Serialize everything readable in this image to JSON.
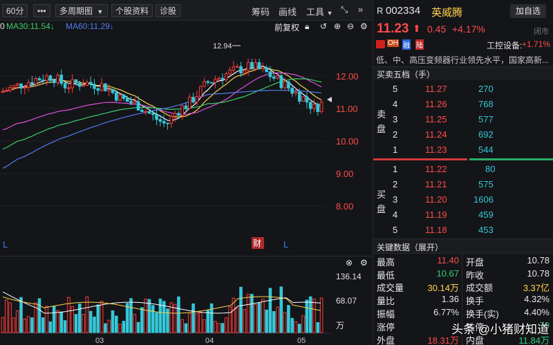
{
  "toolbar": {
    "period": "60分",
    "more": "•••",
    "multi_period": "多周期图",
    "dropdown_arrow": "▼",
    "stock_info": "个股资料",
    "diagnose": "诊股",
    "chips": "筹码",
    "draw_line": "画线",
    "tools": "工具",
    "fuquan": "前复权"
  },
  "ma_legend": {
    "ma_prefix": "0",
    "ma30": "MA30:11.54",
    "ma60": "MA60:11.29",
    "arrow_down": "↓",
    "colors": {
      "ma30": "#3ad06a",
      "ma60": "#4f7df0"
    }
  },
  "price_axis": {
    "labels": [
      "12.00",
      "11.00",
      "10.00",
      "9.00",
      "8.00"
    ],
    "values": [
      12.0,
      11.0,
      10.0,
      9.0,
      8.0
    ],
    "max_marker": "12.94"
  },
  "markers": {
    "left_l": "L",
    "cai": "财",
    "right_l": "L"
  },
  "volume": {
    "axis_labels": [
      "136.14",
      "68.07"
    ],
    "unit": "万",
    "x_labels": [
      "03",
      "04",
      "05"
    ]
  },
  "quote": {
    "market": "R",
    "code": "002334",
    "name": "英威腾",
    "add_watch": "加自选",
    "price": "11.23",
    "change": "0.45",
    "change_pct": "+4.17%",
    "status": "闭市",
    "tags": [
      "OH",
      "融",
      "陆"
    ],
    "sector": "工控设备:",
    "sector_pct": "+1.71%",
    "desc": "低、中、高压变频器行业领先水平，国家高新..."
  },
  "orderbook": {
    "title": "买卖五档（手）",
    "sell_label": [
      "卖",
      "盘"
    ],
    "buy_label": [
      "买",
      "盘"
    ],
    "sell": [
      {
        "level": "5",
        "price": "11.27",
        "vol": "270"
      },
      {
        "level": "4",
        "price": "11.26",
        "vol": "768"
      },
      {
        "level": "3",
        "price": "11.25",
        "vol": "577"
      },
      {
        "level": "2",
        "price": "11.24",
        "vol": "692"
      },
      {
        "level": "1",
        "price": "11.23",
        "vol": "544"
      }
    ],
    "buy": [
      {
        "level": "1",
        "price": "11.22",
        "vol": "80"
      },
      {
        "level": "2",
        "price": "11.21",
        "vol": "575"
      },
      {
        "level": "3",
        "price": "11.20",
        "vol": "1606"
      },
      {
        "level": "4",
        "price": "11.19",
        "vol": "459"
      },
      {
        "level": "5",
        "price": "11.18",
        "vol": "453"
      }
    ]
  },
  "key_data": {
    "title": "关键数据（展开）",
    "rows": [
      {
        "l1": "最高",
        "v1": "11.40",
        "l2": "开盘",
        "v2": "10.78"
      },
      {
        "l1": "最低",
        "v1": "10.67",
        "l2": "昨收",
        "v2": "10.78"
      },
      {
        "l1": "成交量",
        "v1": "30.14万",
        "l2": "成交额",
        "v2": "3.37亿"
      },
      {
        "l1": "量比",
        "v1": "1.36",
        "l2": "换手",
        "v2": "4.32%"
      },
      {
        "l1": "振幅",
        "v1": "6.77%",
        "l2": "换手(实)",
        "v2": "4.40%"
      },
      {
        "l1": "涨停",
        "v1": "",
        "l2": "跌停",
        "v2": "70"
      },
      {
        "l1": "外盘",
        "v1": "18.31万",
        "l2": "内盘",
        "v2": "11.84万"
      }
    ]
  },
  "watermark": "头条 @小猪财知道"
}
